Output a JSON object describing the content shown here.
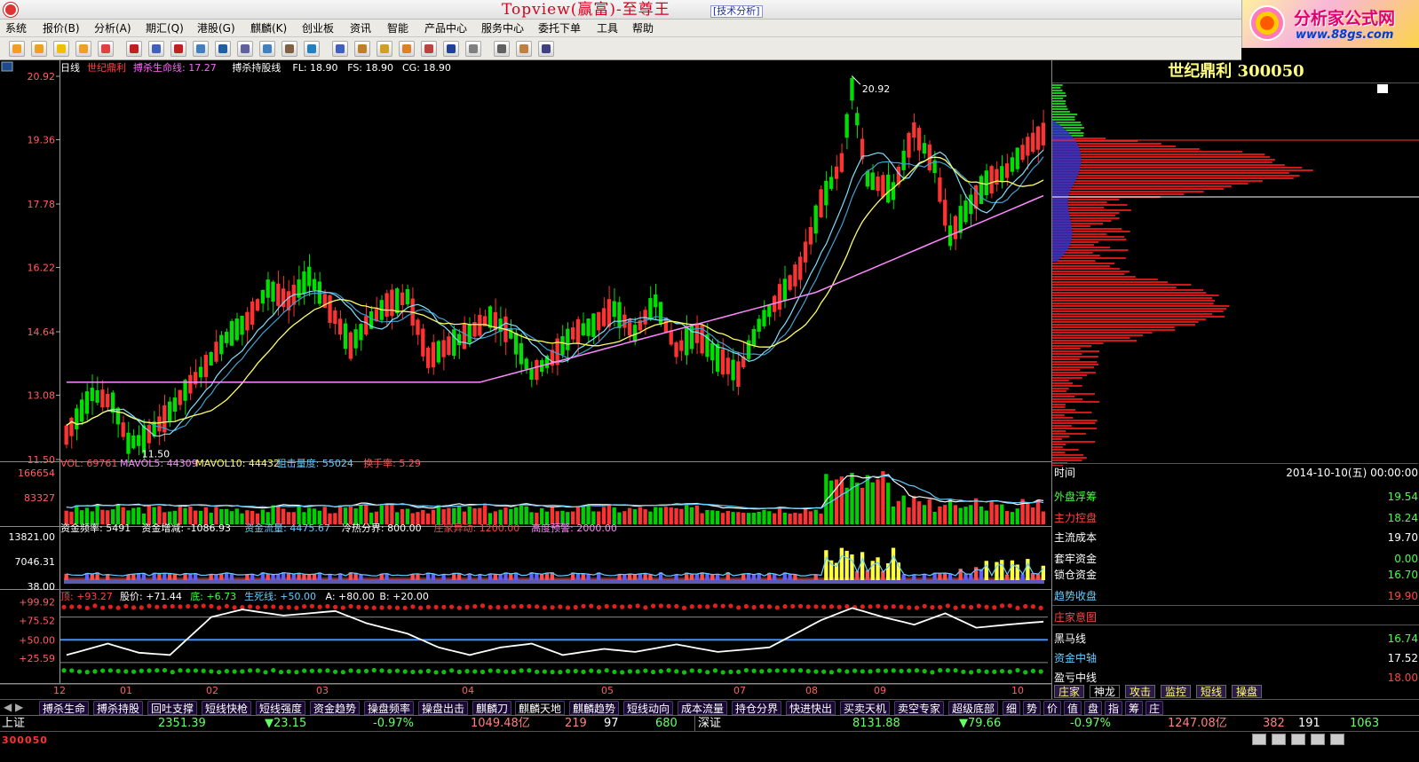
{
  "window": {
    "title": "Topview(赢富)-至尊王",
    "mode": "[技术分析]"
  },
  "brand": {
    "name": "分析家公式网",
    "url": "www.88gs.com"
  },
  "menu": [
    "系统",
    "报价(B)",
    "分析(A)",
    "期汇(Q)",
    "港股(G)",
    "麒麟(K)",
    "创业板",
    "资讯",
    "智能",
    "产品中心",
    "服务中心",
    "委托下单",
    "工具",
    "帮助"
  ],
  "chart_data": [
    {
      "type": "candlestick",
      "title": "世纪鼎利",
      "period": "日线",
      "indicators": [
        {
          "name": "搏杀生命线",
          "value": "17.27",
          "color": "#ff66ff"
        },
        {
          "name": "搏杀持股线",
          "value": "",
          "color": "#ffffff"
        },
        {
          "name": "FL",
          "value": "18.90",
          "color": "#ffffff"
        },
        {
          "name": "FS",
          "value": "18.90",
          "color": "#ffffff"
        },
        {
          "name": "CG",
          "value": "18.90",
          "color": "#ffffff"
        }
      ],
      "yticks": [
        "20.92",
        "19.36",
        "17.78",
        "16.22",
        "14.64",
        "13.08",
        "11.50"
      ],
      "ylim": [
        11.5,
        20.92
      ],
      "annotations": [
        {
          "text": "20.92",
          "type": "max"
        },
        {
          "text": "11.50",
          "type": "min"
        }
      ],
      "xticks": [
        "12",
        "01",
        "02",
        "03",
        "04",
        "05",
        "07",
        "08",
        "09",
        "10"
      ],
      "date_range": [
        "2013-12",
        "2014-10-10"
      ]
    },
    {
      "type": "bar",
      "title": "VOL",
      "items": [
        {
          "name": "VOL",
          "value": "69761",
          "color": "#ff5555"
        },
        {
          "name": "MAVOL5",
          "value": "44309",
          "color": "#ff88ff"
        },
        {
          "name": "MAVOL10",
          "value": "44432",
          "color": "#ffff66"
        },
        {
          "name": "狙击量度",
          "value": "55024",
          "color": "#66ccff"
        },
        {
          "name": "换手率",
          "value": "5.29",
          "color": "#ff5555"
        }
      ],
      "yticks": [
        "166654",
        "83327"
      ]
    },
    {
      "type": "bar",
      "title": "资金频率",
      "items": [
        {
          "name": "资金频率",
          "value": "5491",
          "color": "#ffffff"
        },
        {
          "name": "资金增减",
          "value": "-1086.93",
          "color": "#ffffff"
        },
        {
          "name": "资金流量",
          "value": "4475.67",
          "color": "#66ccff"
        },
        {
          "name": "冷热分界",
          "value": "800.00",
          "color": "#ffffff"
        },
        {
          "name": "庄家异动",
          "value": "1200.00",
          "color": "#ff4444"
        },
        {
          "name": "高度预警",
          "value": "2000.00",
          "color": "#ff88ff"
        }
      ],
      "yticks": [
        "13821.00",
        "7046.31",
        "38.00"
      ]
    },
    {
      "type": "line",
      "title": "麒麟天地",
      "items": [
        {
          "name": "顶",
          "value": "+93.27",
          "color": "#ff4444"
        },
        {
          "name": "股价",
          "value": "+71.44",
          "color": "#ffffff"
        },
        {
          "name": "底",
          "value": "+6.73",
          "color": "#44ff44"
        },
        {
          "name": "生死线",
          "value": "+50.00",
          "color": "#66ccff"
        },
        {
          "name": "A",
          "value": "+80.00",
          "color": "#ffffff"
        },
        {
          "name": "B",
          "value": "+20.00",
          "color": "#ffffff"
        }
      ],
      "yticks": [
        "+99.92",
        "+75.52",
        "+50.00",
        "+25.59"
      ]
    }
  ],
  "right_panel": {
    "stock": "世纪鼎利  300050",
    "time_label": "时间",
    "time_value": "2014-10-10(五) 00:00:00",
    "rows": [
      {
        "label": "外盘浮筹",
        "value": "19.54",
        "lc": "#44ff44",
        "vc": "#44ff44"
      },
      {
        "label": "主力控盘",
        "value": "18.24",
        "lc": "#ff4444",
        "vc": "#44ff44"
      },
      {
        "label": "主流成本",
        "value": "19.70",
        "lc": "#ffffff",
        "vc": "#ffffff"
      },
      {
        "label": "套牢资金",
        "value": "0.00",
        "lc": "#ffffff",
        "vc": "#44ff44"
      },
      {
        "label": "锁仓资金",
        "value": "16.70",
        "lc": "#ffffff",
        "vc": "#44ff44"
      },
      {
        "label": "趋势收盘",
        "value": "19.90",
        "lc": "#66ccff",
        "vc": "#ff4444"
      },
      {
        "label": "庄家意图",
        "value": "",
        "lc": "#ff4444",
        "vc": "#ff4444"
      },
      {
        "label": "黑马线",
        "value": "16.74",
        "lc": "#ffffff",
        "vc": "#44ff44"
      },
      {
        "label": "资金中轴",
        "value": "17.52",
        "lc": "#66ccff",
        "vc": "#ffffff"
      },
      {
        "label": "盈亏中线",
        "value": "18.00",
        "lc": "#ffffff",
        "vc": "#ff4444"
      }
    ],
    "tabs": [
      "庄家",
      "神龙",
      "攻击",
      "监控",
      "短线",
      "操盘"
    ]
  },
  "bottom_tabs": [
    "搏杀生命",
    "搏杀持股",
    "回吐支撑",
    "短线快枪",
    "短线强度",
    "资金趋势",
    "操盘频率",
    "操盘出击",
    "麒麟刀",
    "麒麟天地",
    "麒麟趋势",
    "短线动向",
    "成本流量",
    "持仓分界",
    "快进快出",
    "买卖天机",
    "卖空专家",
    "超级底部",
    "细",
    "势",
    "价",
    "值",
    "盘",
    "指",
    "筹",
    "庄"
  ],
  "status": {
    "sh": {
      "name": "上证",
      "index": "2351.39",
      "chg": "▼23.15",
      "pct": "-0.97%",
      "amount": "1049.48亿",
      "up": "219",
      "flat": "97",
      "down": "680"
    },
    "sz": {
      "name": "深证",
      "index": "8131.88",
      "chg": "▼79.66",
      "pct": "-0.97%",
      "amount": "1247.08亿",
      "up": "382",
      "flat": "191",
      "down": "1063"
    },
    "code": "300050"
  }
}
